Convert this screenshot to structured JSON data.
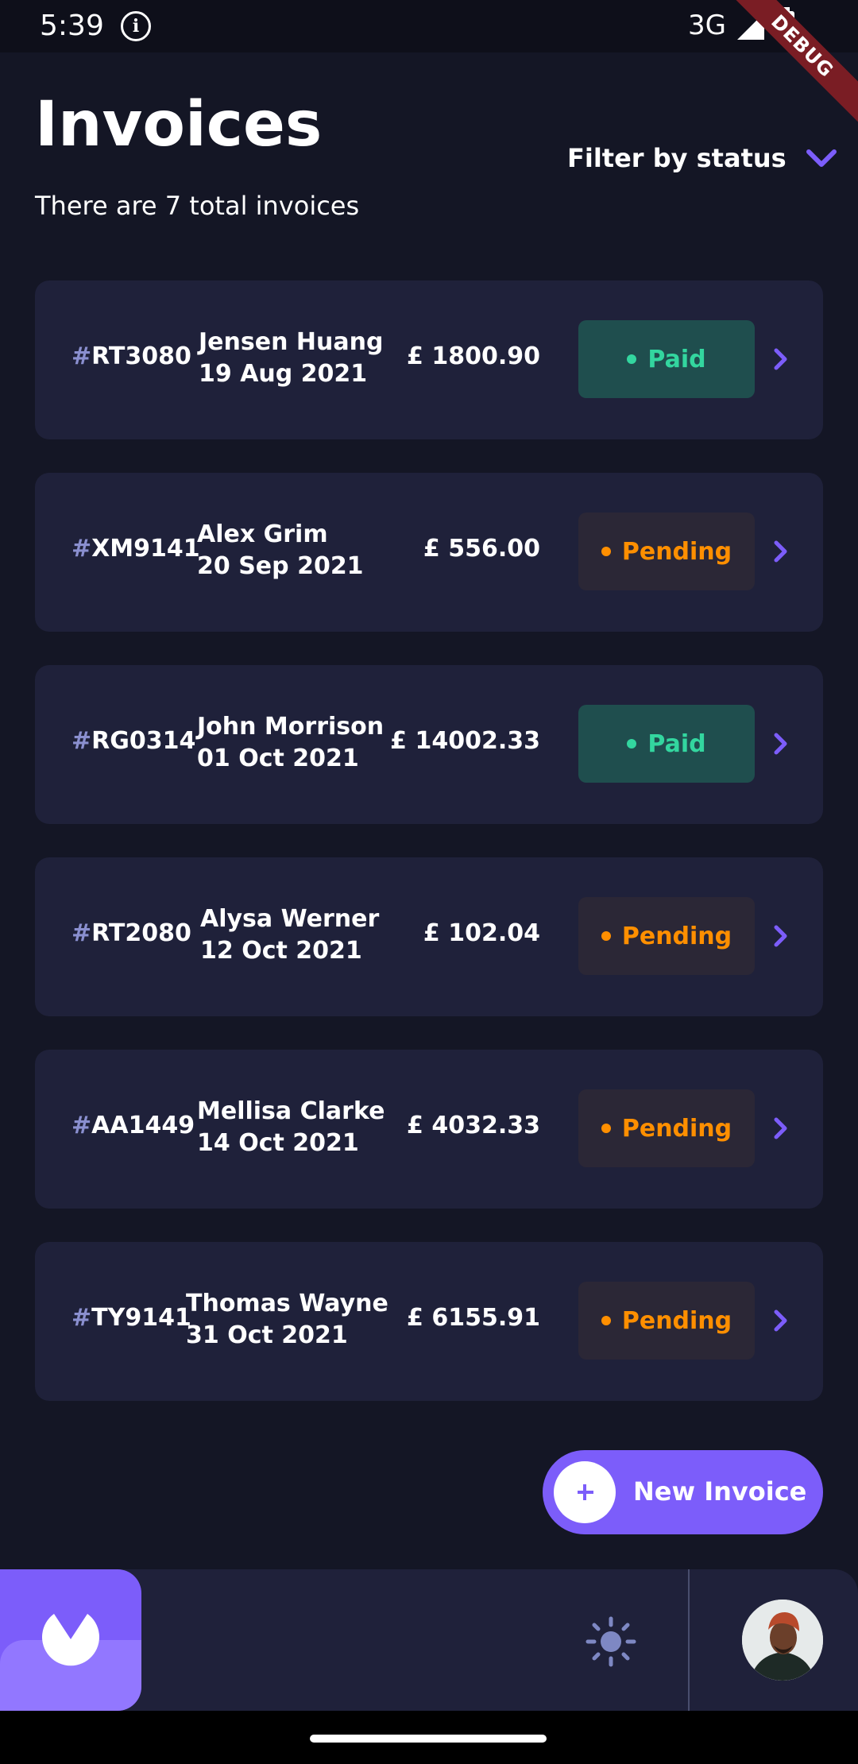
{
  "status_bar": {
    "time": "5:39",
    "network": "3G",
    "debug_label": "DEBUG"
  },
  "header": {
    "title": "Invoices",
    "subtitle": "There are 7 total invoices",
    "filter_label": "Filter by status"
  },
  "invoices": [
    {
      "hash": "#",
      "id": "RT3080",
      "client": "Jensen Huang",
      "date": "19 Aug 2021",
      "amount": "£ 1800.90",
      "status": "Paid"
    },
    {
      "hash": "#",
      "id": "XM9141",
      "client": "Alex Grim",
      "date": "20 Sep 2021",
      "amount": "£ 556.00",
      "status": "Pending"
    },
    {
      "hash": "#",
      "id": "RG0314",
      "client": "John Morrison",
      "date": "01 Oct 2021",
      "amount": "£ 14002.33",
      "status": "Paid"
    },
    {
      "hash": "#",
      "id": "RT2080",
      "client": "Alysa Werner",
      "date": "12 Oct 2021",
      "amount": "£ 102.04",
      "status": "Pending"
    },
    {
      "hash": "#",
      "id": "AA1449",
      "client": "Mellisa Clarke",
      "date": "14 Oct 2021",
      "amount": "£ 4032.33",
      "status": "Pending"
    },
    {
      "hash": "#",
      "id": "TY9141",
      "client": "Thomas Wayne",
      "date": "31 Oct 2021",
      "amount": "£ 6155.91",
      "status": "Pending"
    }
  ],
  "actions": {
    "new_invoice_label": "New Invoice"
  },
  "colors": {
    "background": "#141625",
    "card": "#1f213a",
    "accent": "#7c5dfa",
    "paid": "#33d69f",
    "pending": "#ff8f00"
  },
  "icons": {
    "filter": "chevron-down-icon",
    "row": "chevron-right-icon",
    "new_invoice": "plus-icon",
    "theme": "sun-icon",
    "logo": "app-logo",
    "avatar": "user-avatar"
  }
}
